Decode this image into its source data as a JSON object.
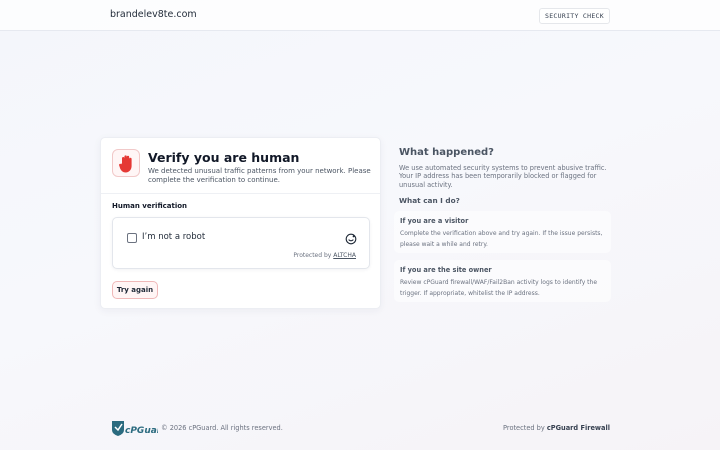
{
  "header": {
    "site": "brandelev8te.com",
    "badge": "SECURITY CHECK"
  },
  "card": {
    "icon": "stop-hand-icon",
    "title": "Verify you are human",
    "subtitle": "We detected unusual traffic patterns from your network. Please complete the verification to continue.",
    "section_label": "Human verification",
    "widget": {
      "checkbox_label": "I’m not a robot",
      "protected_prefix": "Protected by",
      "protected_link": "ALTCHA",
      "icon": "altcha-icon"
    },
    "retry_label": "Try again"
  },
  "info": {
    "heading": "What happened?",
    "description": "We use automated security systems to prevent abusive traffic. Your IP address has been temporarily blocked or flagged for unusual activity.",
    "subheading": "What can I do?",
    "visitor": {
      "title": "If you are a visitor",
      "text": "Complete the verification above and try again. If the issue persists, please wait a while and retry."
    },
    "owner": {
      "title": "If you are the site owner",
      "text": "Review cPGuard firewall/WAF/Fail2Ban activity logs to identify the trigger. If appropriate, whitelist the IP address."
    }
  },
  "footer": {
    "logo_text": "cPGuard",
    "copyright": "© 2026 cPGuard. All rights reserved.",
    "powered_prefix": "Protected by",
    "powered_brand": "cPGuard Firewall"
  },
  "colors": {
    "accent_red": "#e53935",
    "logo_teal": "#2b6b7f"
  }
}
